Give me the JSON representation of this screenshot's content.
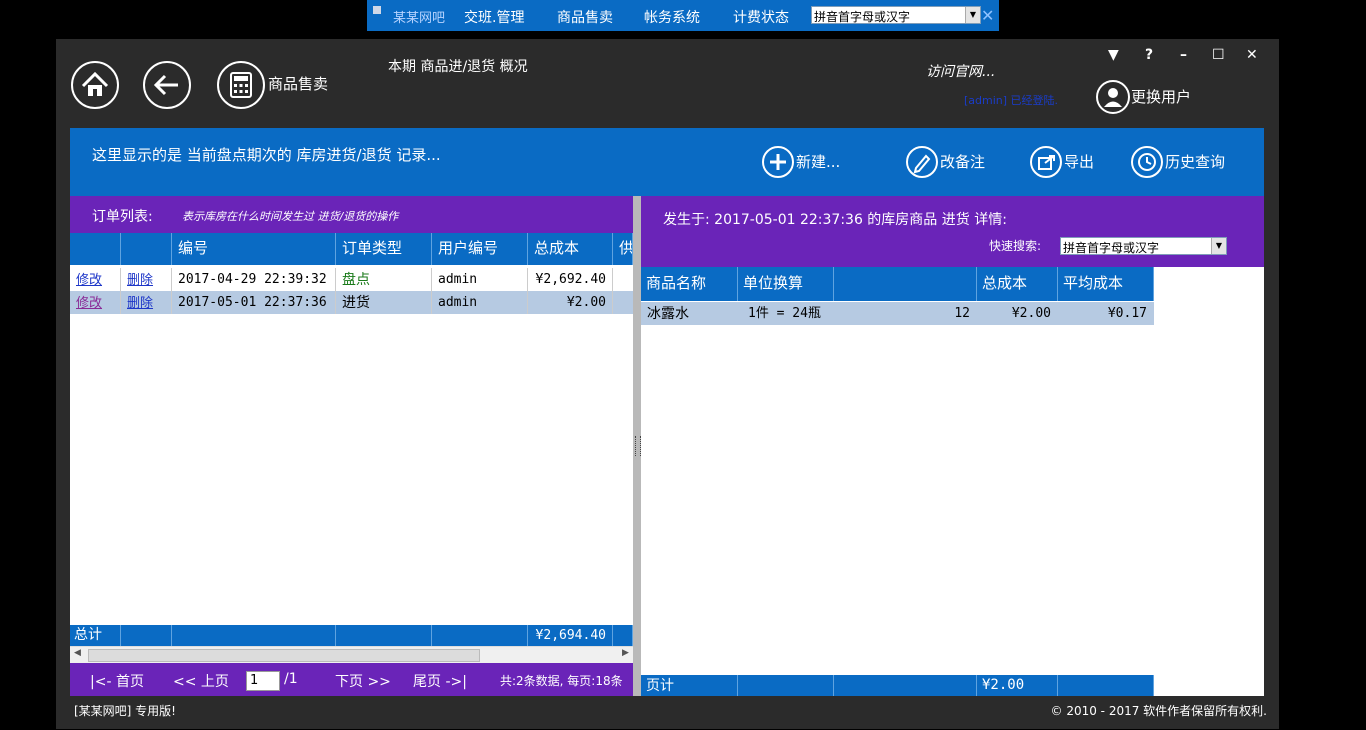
{
  "topbar": {
    "brand": "某某网吧",
    "menu": [
      "交班.管理",
      "商品售卖",
      "帐务系统",
      "计费状态"
    ],
    "search_placeholder": "拼音首字母或汉字"
  },
  "header": {
    "module_label": "商品售卖",
    "title": "本期 商品进/退货 概况",
    "website_link": "访问官网...",
    "login_status": "[admin] 已经登陆.",
    "switch_user": "更换用户"
  },
  "window_controls": [
    "▼",
    "?",
    "–",
    "☐",
    "✕"
  ],
  "banner": {
    "message": "这里显示的是 当前盘点期次的 库房进货/退货 记录...",
    "buttons": [
      "新建...",
      "改备注",
      "导出",
      "历史查询"
    ]
  },
  "orders": {
    "title": "订单列表:",
    "hint": "表示库房在什么时间发生过 进货/退货的操作",
    "columns": [
      "",
      "",
      "编号",
      "订单类型",
      "用户编号",
      "总成本",
      "供"
    ],
    "rows": [
      {
        "edit": "修改",
        "del": "删除",
        "id": "2017-04-29 22:39:32",
        "type": "盘点",
        "user": "admin",
        "cost": "¥2,692.40"
      },
      {
        "edit": "修改",
        "del": "删除",
        "id": "2017-05-01 22:37:36",
        "type": "进货",
        "user": "admin",
        "cost": "¥2.00"
      }
    ],
    "total_label": "总计",
    "total_cost": "¥2,694.40"
  },
  "pager": {
    "first": "|<- 首页",
    "prev": "<< 上页",
    "page": "1",
    "of": "/1",
    "next": "下页 >>",
    "last": "尾页 ->|",
    "summary": "共:2条数据, 每页:18条"
  },
  "detail": {
    "title": "发生于: 2017-05-01 22:37:36 的库房商品 进货 详情:",
    "search_label": "快速搜索:",
    "search_placeholder": "拼音首字母或汉字",
    "columns": [
      "商品名称",
      "单位换算",
      "",
      "总成本",
      "平均成本"
    ],
    "rows": [
      {
        "name": "冰露水",
        "unit": "1件 = 24瓶",
        "qty": "12",
        "cost": "¥2.00",
        "avg": "¥0.17"
      }
    ],
    "footer_label": "页计",
    "footer_cost": "¥2.00"
  },
  "footer": {
    "left": "[某某网吧] 专用版!",
    "right": "© 2010 - 2017 软件作者保留所有权利."
  },
  "colors": {
    "blue": "#0a6bc4",
    "purple": "#6a24b8",
    "window": "#2b2b2b",
    "row_selected": "#b6cae2"
  }
}
